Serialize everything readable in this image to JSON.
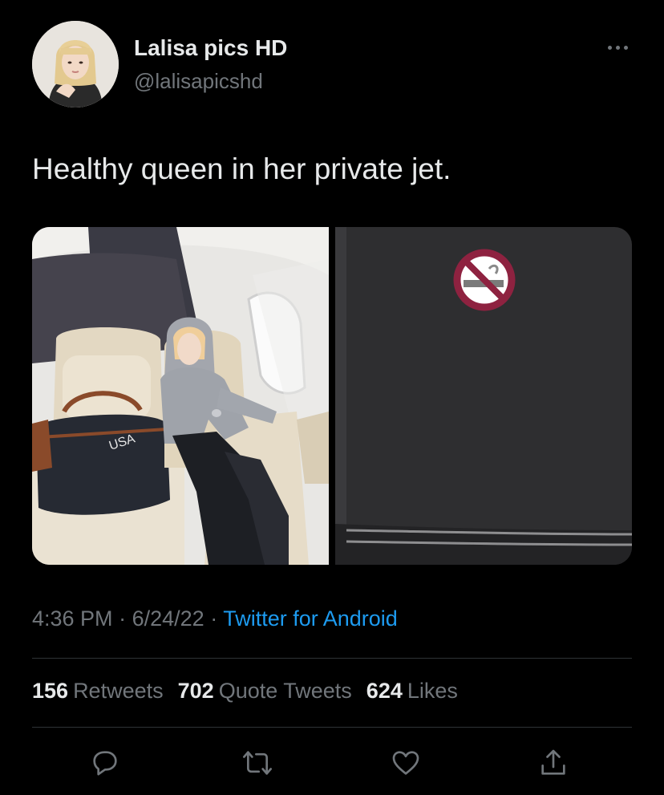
{
  "author": {
    "display_name": "Lalisa pics HD",
    "handle": "@lalisapicshd"
  },
  "tweet": {
    "text": "Healthy queen in her private jet.",
    "time": "4:36 PM",
    "date": "6/24/22",
    "separator": "·",
    "source": "Twitter for Android"
  },
  "media": {
    "photos": [
      {
        "bag_text": "USA"
      },
      {
        "icon": "no-smoking-icon"
      }
    ]
  },
  "stats": {
    "retweets_count": "156",
    "retweets_label": "Retweets",
    "quotes_count": "702",
    "quotes_label": "Quote Tweets",
    "likes_count": "624",
    "likes_label": "Likes"
  },
  "actions": [
    "reply-icon",
    "retweet-icon",
    "like-icon",
    "share-icon"
  ],
  "colors": {
    "background": "#000000",
    "primary_text": "#e7e9ea",
    "secondary_text": "#71767b",
    "link": "#1d9bf0",
    "divider": "#2f3336"
  }
}
